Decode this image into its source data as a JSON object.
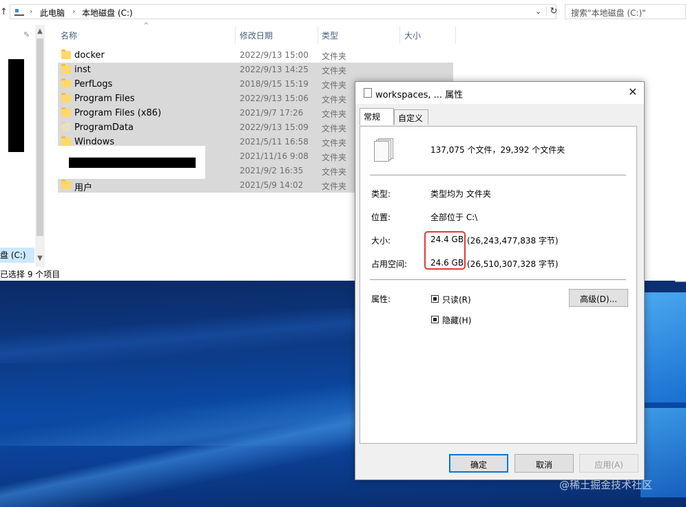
{
  "explorer": {
    "breadcrumb": [
      "此电脑",
      "本地磁盘 (C:)"
    ],
    "search_placeholder": "搜索\"本地磁盘 (C:)\"",
    "columns": [
      "名称",
      "修改日期",
      "类型",
      "大小"
    ],
    "rows": [
      {
        "name": "docker",
        "date": "2022/9/13 15:00",
        "type": "文件夹",
        "selected": false
      },
      {
        "name": "inst",
        "date": "2022/9/13 14:25",
        "type": "文件夹",
        "selected": true
      },
      {
        "name": "PerfLogs",
        "date": "2018/9/15 15:19",
        "type": "文件夹",
        "selected": true
      },
      {
        "name": "Program Files",
        "date": "2022/9/13 15:06",
        "type": "文件夹",
        "selected": true
      },
      {
        "name": "Program Files (x86)",
        "date": "2021/9/7 17:26",
        "type": "文件夹",
        "selected": true
      },
      {
        "name": "ProgramData",
        "date": "2022/9/13 15:09",
        "type": "文件夹",
        "selected": true
      },
      {
        "name": "Windows",
        "date": "2021/5/11 16:58",
        "type": "文件夹",
        "selected": true
      },
      {
        "name": "",
        "date": "2021/11/16 9:08",
        "type": "文件夹",
        "selected": true
      },
      {
        "name": "",
        "date": "2021/9/2 16:35",
        "type": "文件夹",
        "selected": true
      },
      {
        "name": "用户",
        "date": "2021/5/9 14:02",
        "type": "文件夹",
        "selected": true
      }
    ],
    "nav_drive_label": "盘 (C:)",
    "status": "已选择 9 个项目"
  },
  "dialog": {
    "title": "workspaces, ... 属性",
    "tabs": [
      "常规",
      "自定义"
    ],
    "files_summary": "137,075 个文件，29,392 个文件夹",
    "type_label": "类型:",
    "type_value": "类型均为 文件夹",
    "location_label": "位置:",
    "location_value": "全部位于 C:\\",
    "size_label": "大小:",
    "size_value": "24.4 GB",
    "size_bytes": "(26,243,477,838 字节)",
    "disk_label": "占用空间:",
    "disk_value": "24.6 GB",
    "disk_bytes": "(26,510,307,328 字节)",
    "attr_label": "属性:",
    "readonly_label": "只读(R)",
    "hidden_label": "隐藏(H)",
    "advanced_button": "高级(D)...",
    "ok_button": "确定",
    "cancel_button": "取消",
    "apply_button": "应用(A)"
  },
  "watermark": "@稀土掘金技术社区",
  "colors": {
    "highlight_box": "#e53935",
    "selection": "#d9d9d9",
    "folder": "#ffd86b",
    "ok_border": "#0078d7"
  }
}
